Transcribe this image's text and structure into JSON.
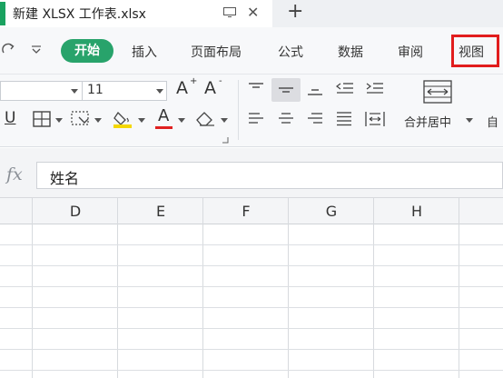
{
  "window": {
    "tab_title": "新建 XLSX 工作表.xlsx",
    "close_glyph": "✕",
    "new_tab_glyph": "+"
  },
  "menu": {
    "items": [
      "开始",
      "插入",
      "页面布局",
      "公式",
      "数据",
      "审阅",
      "视图"
    ],
    "highlighted": "视图"
  },
  "ribbon": {
    "font_size": "11",
    "merge_label": "合并居中",
    "autowrap_label": "自",
    "grow_font_glyph": "A",
    "shrink_font_glyph": "A",
    "font_color_glyph": "A",
    "font_color": "#e02020",
    "highlight_color": "#f4d700",
    "underline_glyph": "U"
  },
  "formula_bar": {
    "fx_label": "fx",
    "value": "姓名"
  },
  "sheet": {
    "columns": [
      "D",
      "E",
      "F",
      "G",
      "H"
    ]
  },
  "colors": {
    "accent_green": "#28a36b",
    "highlight_red": "#e11d1d"
  }
}
